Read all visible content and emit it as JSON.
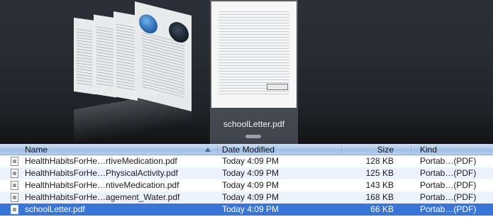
{
  "coverflow": {
    "caption": "schoolLetter.pdf"
  },
  "list": {
    "columns": {
      "name": "Name",
      "date": "Date Modified",
      "size": "Size",
      "kind": "Kind"
    },
    "rows": [
      {
        "name": "HealthHabitsForHe…rtiveMedication.pdf",
        "date": "Today 4:09 PM",
        "size": "128 KB",
        "kind": "Portab…(PDF)"
      },
      {
        "name": "HealthHabitsForHe…PhysicalActivity.pdf",
        "date": "Today 4:09 PM",
        "size": "125 KB",
        "kind": "Portab…(PDF)"
      },
      {
        "name": "HealthHabitsForHe…ntiveMedication.pdf",
        "date": "Today 4:09 PM",
        "size": "143 KB",
        "kind": "Portab…(PDF)"
      },
      {
        "name": "HealthHabitsForHe…agement_Water.pdf",
        "date": "Today 4:09 PM",
        "size": "168 KB",
        "kind": "Portab…(PDF)"
      },
      {
        "name": "schoolLetter.pdf",
        "date": "Today 4:09 PM",
        "size": "66 KB",
        "kind": "Portab…(PDF)"
      }
    ],
    "selected_index": 4,
    "sort_column": "name"
  },
  "colors": {
    "selection": "#3875d7",
    "alt_row": "#edf3fe",
    "coverflow_bg": "#262a31"
  }
}
